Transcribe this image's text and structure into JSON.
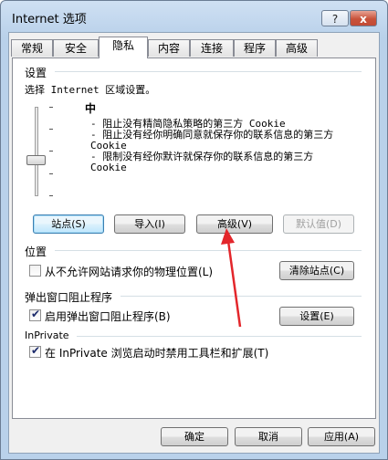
{
  "window": {
    "title": "Internet 选项",
    "help_label": "?",
    "close_label": "x"
  },
  "tabs": [
    {
      "label": "常规"
    },
    {
      "label": "安全"
    },
    {
      "label": "隐私"
    },
    {
      "label": "内容"
    },
    {
      "label": "连接"
    },
    {
      "label": "程序"
    },
    {
      "label": "高级"
    }
  ],
  "settings": {
    "heading": "设置",
    "zone_prompt": "选择 Internet 区域设置。",
    "level": "中",
    "descriptions": [
      "- 阻止没有精简隐私策略的第三方 Cookie",
      "- 阻止没有经你明确同意就保存你的联系信息的第三方 Cookie",
      "- 限制没有经你默许就保存你的联系信息的第三方 Cookie"
    ],
    "slider_level": 0.5,
    "buttons": {
      "sites": "站点(S)",
      "import": "导入(I)",
      "advanced": "高级(V)",
      "default": "默认值(D)"
    }
  },
  "location": {
    "heading": "位置",
    "never_allow_label": "从不允许网站请求你的物理位置(L)",
    "never_allow_checked": false,
    "clear_sites": "清除站点(C)"
  },
  "popup": {
    "heading": "弹出窗口阻止程序",
    "enable_label": "启用弹出窗口阻止程序(B)",
    "enable_checked": true,
    "settings_button": "设置(E)"
  },
  "inprivate": {
    "heading": "InPrivate",
    "disable_label": "在 InPrivate 浏览启动时禁用工具栏和扩展(T)",
    "disable_checked": true
  },
  "footer": {
    "ok": "确定",
    "cancel": "取消",
    "apply": "应用(A)"
  },
  "colors": {
    "arrow": "#e3262b",
    "accent": "#3c7fb1"
  }
}
